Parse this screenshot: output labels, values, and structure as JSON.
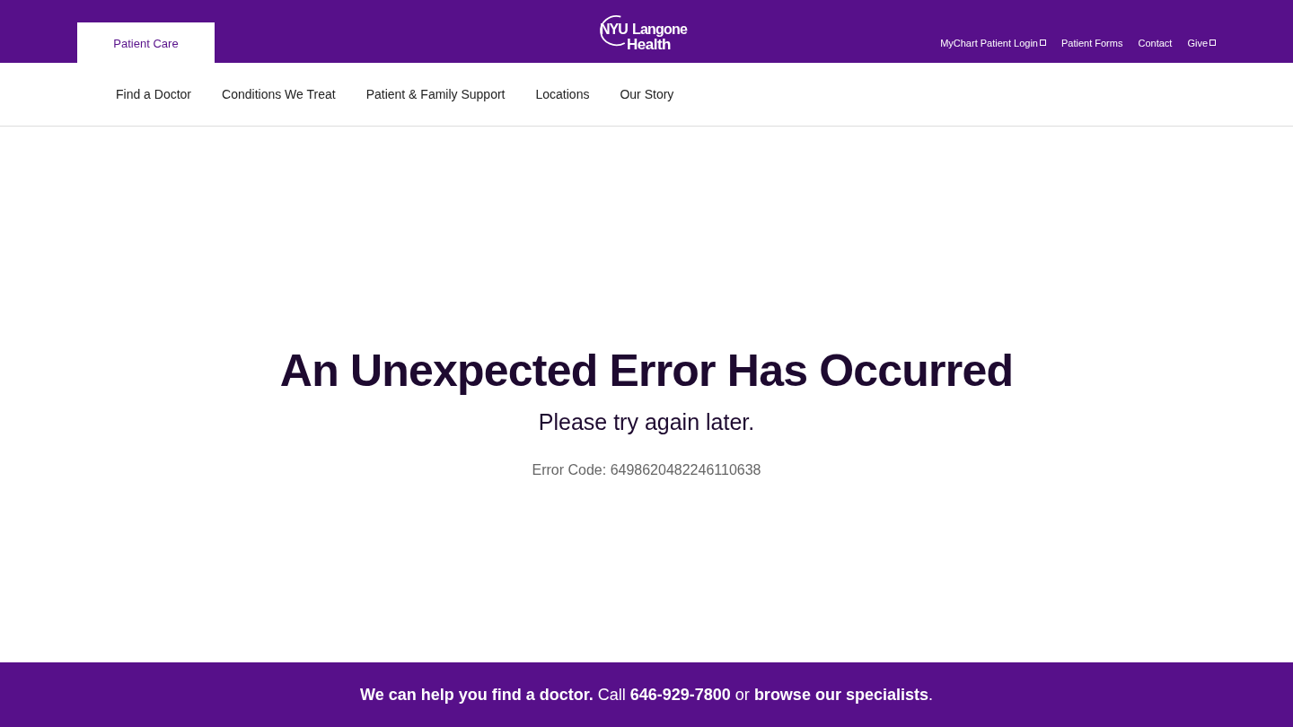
{
  "header": {
    "tabs": [
      {
        "label": "Patient Care",
        "selected": true
      }
    ],
    "logo": {
      "line_1": "NYU",
      "line_2": "Langone",
      "line_3": "Health"
    },
    "utility_links": [
      {
        "label": "MyChart Patient Login",
        "external": true
      },
      {
        "label": "Patient Forms",
        "external": false
      },
      {
        "label": "Contact",
        "external": false
      },
      {
        "label": "Give",
        "external": true
      }
    ]
  },
  "nav": {
    "items": [
      "Find a Doctor",
      "Conditions We Treat",
      "Patient & Family Support",
      "Locations",
      "Our Story"
    ]
  },
  "error": {
    "title": "An Unexpected Error Has Occurred",
    "subtitle": "Please try again later.",
    "code": "Error Code: 6498620482246110638"
  },
  "footer": {
    "lead": "**We can help you find a doctor.** Call **646-929-7800** or",
    "link": "browse our specialists",
    "end": "."
  }
}
